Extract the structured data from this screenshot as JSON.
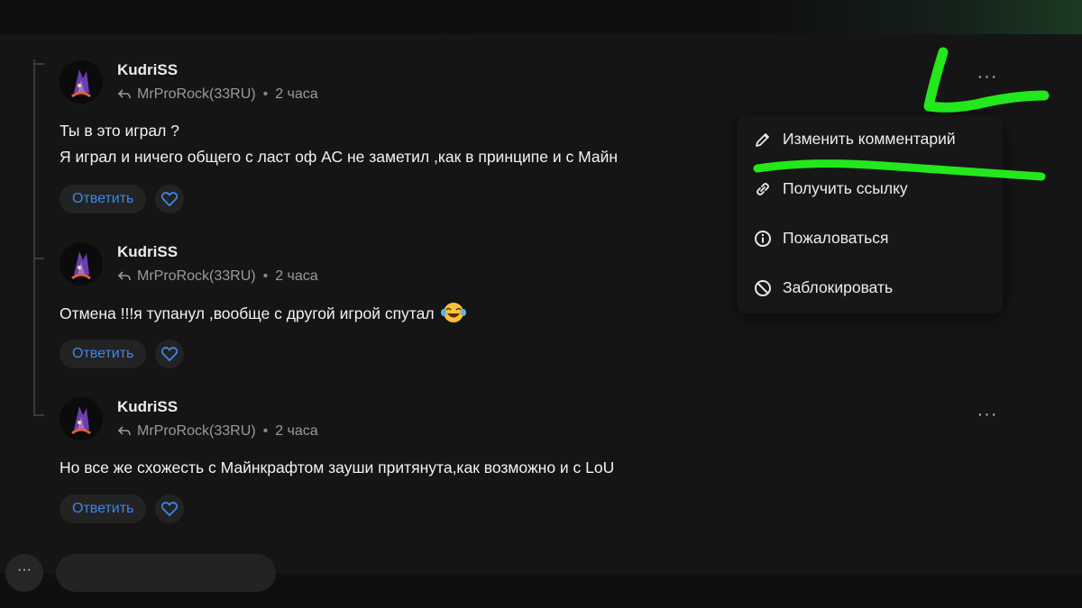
{
  "comments": [
    {
      "author": "KudriSS",
      "reply_to": "MrProRock(33RU)",
      "time": "2 часа",
      "lines": [
        "Ты в это играл ?",
        "Я играл и ничего общего с ласт оф АС не заметил ,как в принципе и с Майн"
      ],
      "reply_label": "Ответить"
    },
    {
      "author": "KudriSS",
      "reply_to": "MrProRock(33RU)",
      "time": "2 часа",
      "lines": [
        "Отмена !!!я тупанул ,вообще с другой игрой спутал"
      ],
      "reply_label": "Ответить"
    },
    {
      "author": "KudriSS",
      "reply_to": "MrProRock(33RU)",
      "time": "2 часа",
      "lines": [
        "Но все же схожесть с Майнкрафтом зауши притянута,как возможно и с LoU"
      ],
      "reply_label": "Ответить"
    }
  ],
  "context_menu": {
    "items": [
      {
        "label": "Изменить комментарий",
        "icon": "pencil-icon"
      },
      {
        "label": "Получить ссылку",
        "icon": "link-icon"
      },
      {
        "label": "Пожаловаться",
        "icon": "info-icon"
      },
      {
        "label": "Заблокировать",
        "icon": "block-icon"
      }
    ]
  },
  "more_label": "···",
  "colors": {
    "background": "#151515",
    "reply_link": "#3f86e6",
    "annotation": "#22e81c"
  }
}
